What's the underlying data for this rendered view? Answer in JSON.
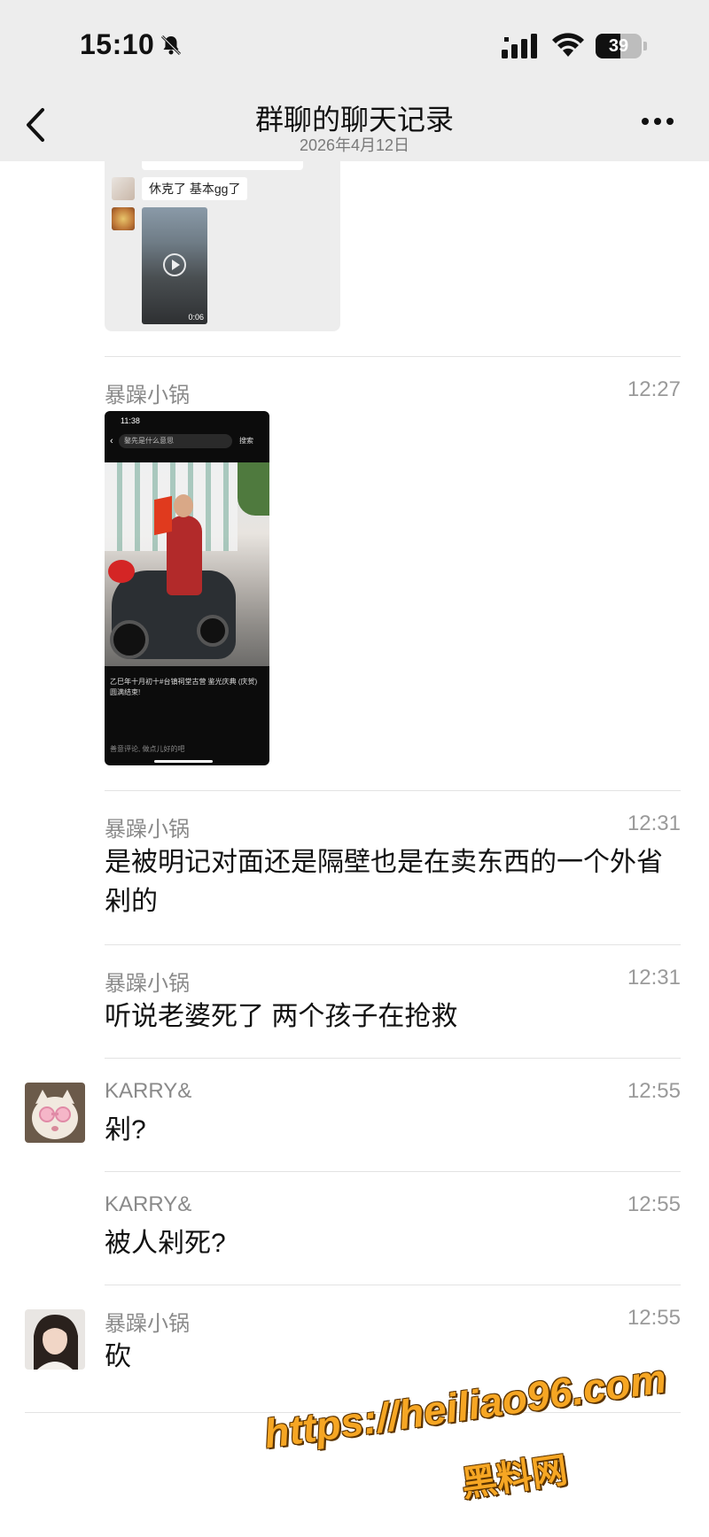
{
  "status_bar": {
    "time": "15:10",
    "battery": "39"
  },
  "nav": {
    "title": "群聊的聊天记录",
    "date": "2026年4月12日"
  },
  "forwarded_card": {
    "message": "休克了 基本gg了",
    "video_duration": "0:06"
  },
  "messages": [
    {
      "sender": "暴躁小锅",
      "time": "12:27",
      "type": "image",
      "screenshot": {
        "time": "11:38",
        "search_placeholder": "鏊先是什么意思",
        "search_button": "搜索",
        "caption": "乙巳年十月初十#台镇祠堂古营 鉴光庆典 (庆贺)圆满结束!",
        "comment_hint": "善意评论, 做点儿好的吧"
      }
    },
    {
      "sender": "暴躁小锅",
      "time": "12:31",
      "text": "是被明记对面还是隔壁也是在卖东西的一个外省剁的"
    },
    {
      "sender": "暴躁小锅",
      "time": "12:31",
      "text": "听说老婆死了 两个孩子在抢救"
    },
    {
      "sender": "KARRY&",
      "time": "12:55",
      "text": "剁?"
    },
    {
      "sender": "KARRY&",
      "time": "12:55",
      "text": "被人剁死?"
    },
    {
      "sender": "暴躁小锅",
      "time": "12:55",
      "text": "砍"
    }
  ],
  "watermark": {
    "url": "https://heiliao96.com",
    "name": "黑料网"
  }
}
